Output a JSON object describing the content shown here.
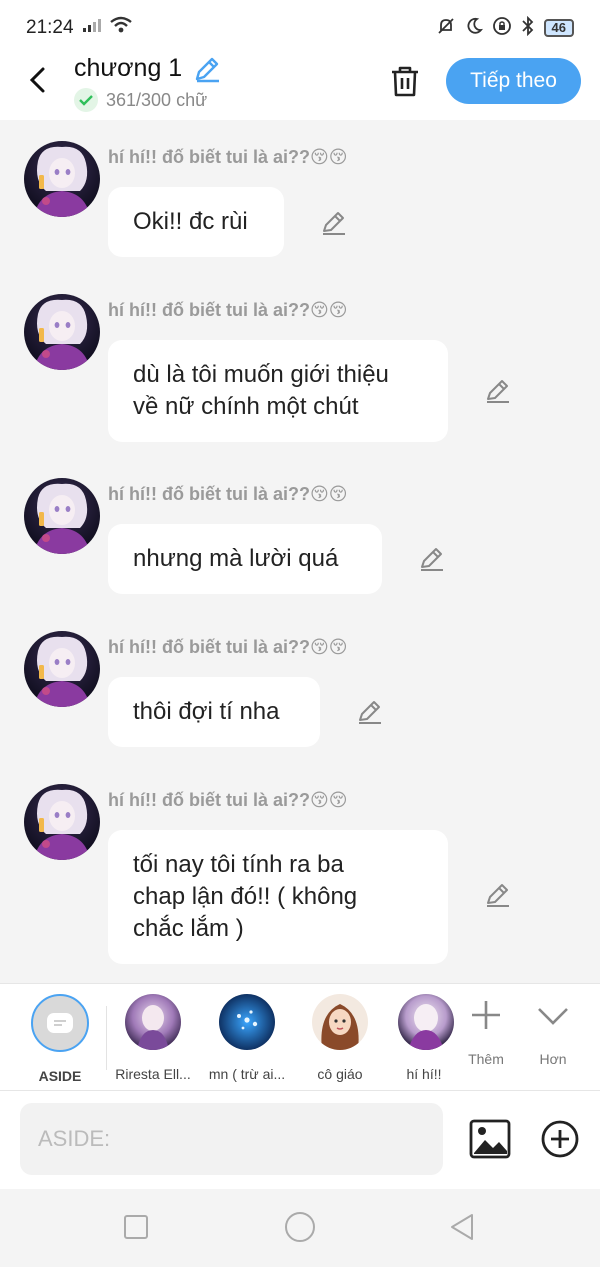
{
  "status_bar": {
    "time": "21:24",
    "battery": "46"
  },
  "header": {
    "title": "chương 1",
    "word_count": "361/300 chữ",
    "next_label": "Tiếp theo"
  },
  "messages": [
    {
      "sender": "hí hí!! đố biết tui là ai??😚😚",
      "lines": [
        "Oki!! đc rùi"
      ]
    },
    {
      "sender": "hí hí!! đố biết tui là ai??😚😚",
      "lines": [
        "dù là tôi muốn giới thiệu",
        "về nữ chính một chút"
      ]
    },
    {
      "sender": "hí hí!! đố biết tui là ai??😚😚",
      "lines": [
        "nhưng mà lười quá"
      ]
    },
    {
      "sender": "hí hí!! đố biết tui là ai??😚😚",
      "lines": [
        "thôi đợi tí nha"
      ]
    },
    {
      "sender": "hí hí!! đố biết tui là ai??😚😚",
      "lines": [
        "tối nay tôi tính ra ba",
        "chap lận đó!! ( không",
        "chắc lắm )"
      ]
    }
  ],
  "characters": [
    {
      "name": "ASIDE"
    },
    {
      "name": "Riresta Ell..."
    },
    {
      "name": "mn ( trừ ai..."
    },
    {
      "name": "cô giáo"
    },
    {
      "name": "hí hí!!"
    }
  ],
  "tools": {
    "more_label": "Thêm",
    "collapse_label": "Hơn"
  },
  "input": {
    "placeholder": "ASIDE:"
  },
  "colors": {
    "accent": "#4aa3f2",
    "bubble": "#ffffff",
    "background": "#f4f4f4"
  }
}
